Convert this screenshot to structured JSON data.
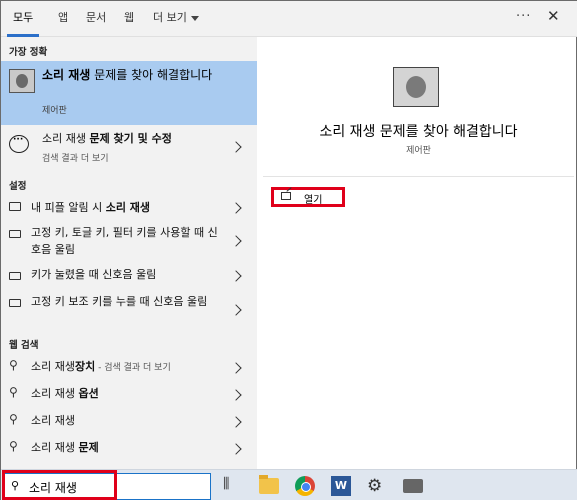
{
  "tabs": [
    "모두",
    "앱",
    "문서",
    "웹",
    "더 보기"
  ],
  "window_controls": {
    "more": "···",
    "close": "✕"
  },
  "sections": {
    "best_match": "가장 정확",
    "settings": "설정",
    "app_search": "웹 검색"
  },
  "best_match": {
    "title_bold": "소리 재생",
    "title_rest": " 문제를 찾아 해결합니다",
    "subtitle": "제어판",
    "icon": "speaker-control-panel-icon"
  },
  "search_suggestion": {
    "prefix": "소리 재생 ",
    "bold": "문제 찾기 및 수정",
    "subtitle": "검색 결과 더 보기",
    "icon": "chat-bubble-icon"
  },
  "settings_items": [
    {
      "prefix": "내 피플 알림 시 ",
      "bold": "소리 재생",
      "icon": "monitor-icon"
    },
    {
      "text": "고정 키, 토글 키, 필터 키를 사용할 때 신호음 울림",
      "icon": "keyboard-icon"
    },
    {
      "text": "키가 눌렸을 때 신호음 울림",
      "icon": "keyboard-icon"
    },
    {
      "text": "고정 키 보조 키를 누를 때 신호음 울림",
      "icon": "keyboard-icon"
    }
  ],
  "web_items": [
    {
      "prefix": "소리 재생",
      "bold": "장치",
      "hint": " - 검색 결과 더 보기"
    },
    {
      "prefix": "소리 재생 ",
      "bold": "옵션",
      "hint": ""
    },
    {
      "prefix": "소리 재생",
      "bold": "",
      "hint": ""
    },
    {
      "prefix": "소리 재생 ",
      "bold": "문제",
      "hint": ""
    }
  ],
  "detail": {
    "title": "소리 재생 문제를 찾아 해결합니다",
    "subtitle": "제어판",
    "open_label": "열기"
  },
  "search": {
    "value": "소리 재생"
  },
  "taskbar_icons": [
    "task-view-icon",
    "file-explorer-icon",
    "chrome-icon",
    "word-icon",
    "settings-gear-icon",
    "app-icon"
  ],
  "colors": {
    "accent": "#2b6fc9",
    "selection": "#a9cbf0",
    "highlight_box": "#e0001a"
  }
}
